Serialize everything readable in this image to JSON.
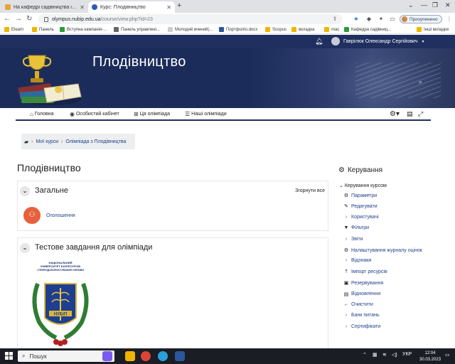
{
  "browser": {
    "tabs": [
      {
        "title": "На кафедрі садівництва ім. про",
        "active": false
      },
      {
        "title": "Курс: Плодівництво",
        "active": true
      }
    ],
    "new_tab": "+",
    "url_host": "olympus.nubip.edu.ua",
    "url_path": "/course/view.php?id=23",
    "profile_label": "Призупинено",
    "bookmarks": [
      "Elearn",
      "Панель",
      "Вступна кампанія-...",
      "Панель управлені...",
      "Молодий вчений|...",
      "Портфоліо.docx",
      "Scopus",
      "вкладка",
      "mac",
      "Кафедра садівниц...",
      "Інші вкладки"
    ]
  },
  "site": {
    "user_name": "Гаврілюк Олександр Сергійович",
    "course_title": "Плодівництво",
    "menu": [
      {
        "label": "Головна",
        "icon": "home-icon"
      },
      {
        "label": "Особистий кабінет",
        "icon": "dashboard-icon"
      },
      {
        "label": "Ця олімпіада",
        "icon": "sitemap-icon"
      },
      {
        "label": "Наші олімпіади",
        "icon": "list-icon"
      }
    ],
    "breadcrumb": [
      "Мої курси",
      "Олімпіада з Плодівництва"
    ],
    "page_title": "Плодівництво"
  },
  "sections": {
    "general": {
      "title": "Загальне",
      "collapse_all": "Згорнути все",
      "activity": "Оголошення"
    },
    "test": {
      "title": "Тестове завдання для олімпіади",
      "emblem_text": "НАЦІОНАЛЬНИЙ УНІВЕРСИТЕТ БІОРЕСУРСІВ І ПРИРОДОКОРИСТУВАННЯ УКРАЇНИ",
      "emblem_short": "НУБіП"
    }
  },
  "admin": {
    "title": "Керування",
    "root": "Керування курсом",
    "items": [
      {
        "label": "Параметри",
        "icon": "gear-icon"
      },
      {
        "label": "Редагувати",
        "icon": "pencil-icon"
      },
      {
        "label": "Користувачі",
        "icon": "chevron-right-icon"
      },
      {
        "label": "Фільтри",
        "icon": "filter-icon"
      },
      {
        "label": "Звіти",
        "icon": "chevron-right-icon"
      },
      {
        "label": "Налаштування журналу оцінок",
        "icon": "gear-icon"
      },
      {
        "label": "Відзнаки",
        "icon": "chevron-right-icon"
      },
      {
        "label": "Імпорт ресурсів",
        "icon": "import-icon"
      },
      {
        "label": "Резервування",
        "icon": "backup-icon"
      },
      {
        "label": "Відновлення",
        "icon": "restore-icon"
      },
      {
        "label": "Очистити",
        "icon": "arrow-left-icon"
      },
      {
        "label": "Банк питань",
        "icon": "chevron-right-icon"
      },
      {
        "label": "Сертифікати",
        "icon": "chevron-right-icon"
      }
    ]
  },
  "taskbar": {
    "search_placeholder": "Пошук",
    "lang": "УКР",
    "time": "12:04",
    "date": "30.03.2023"
  },
  "colors": {
    "navy": "#1f2f5f",
    "link": "#1f3f8a",
    "forum_orange": "#e8603c"
  }
}
